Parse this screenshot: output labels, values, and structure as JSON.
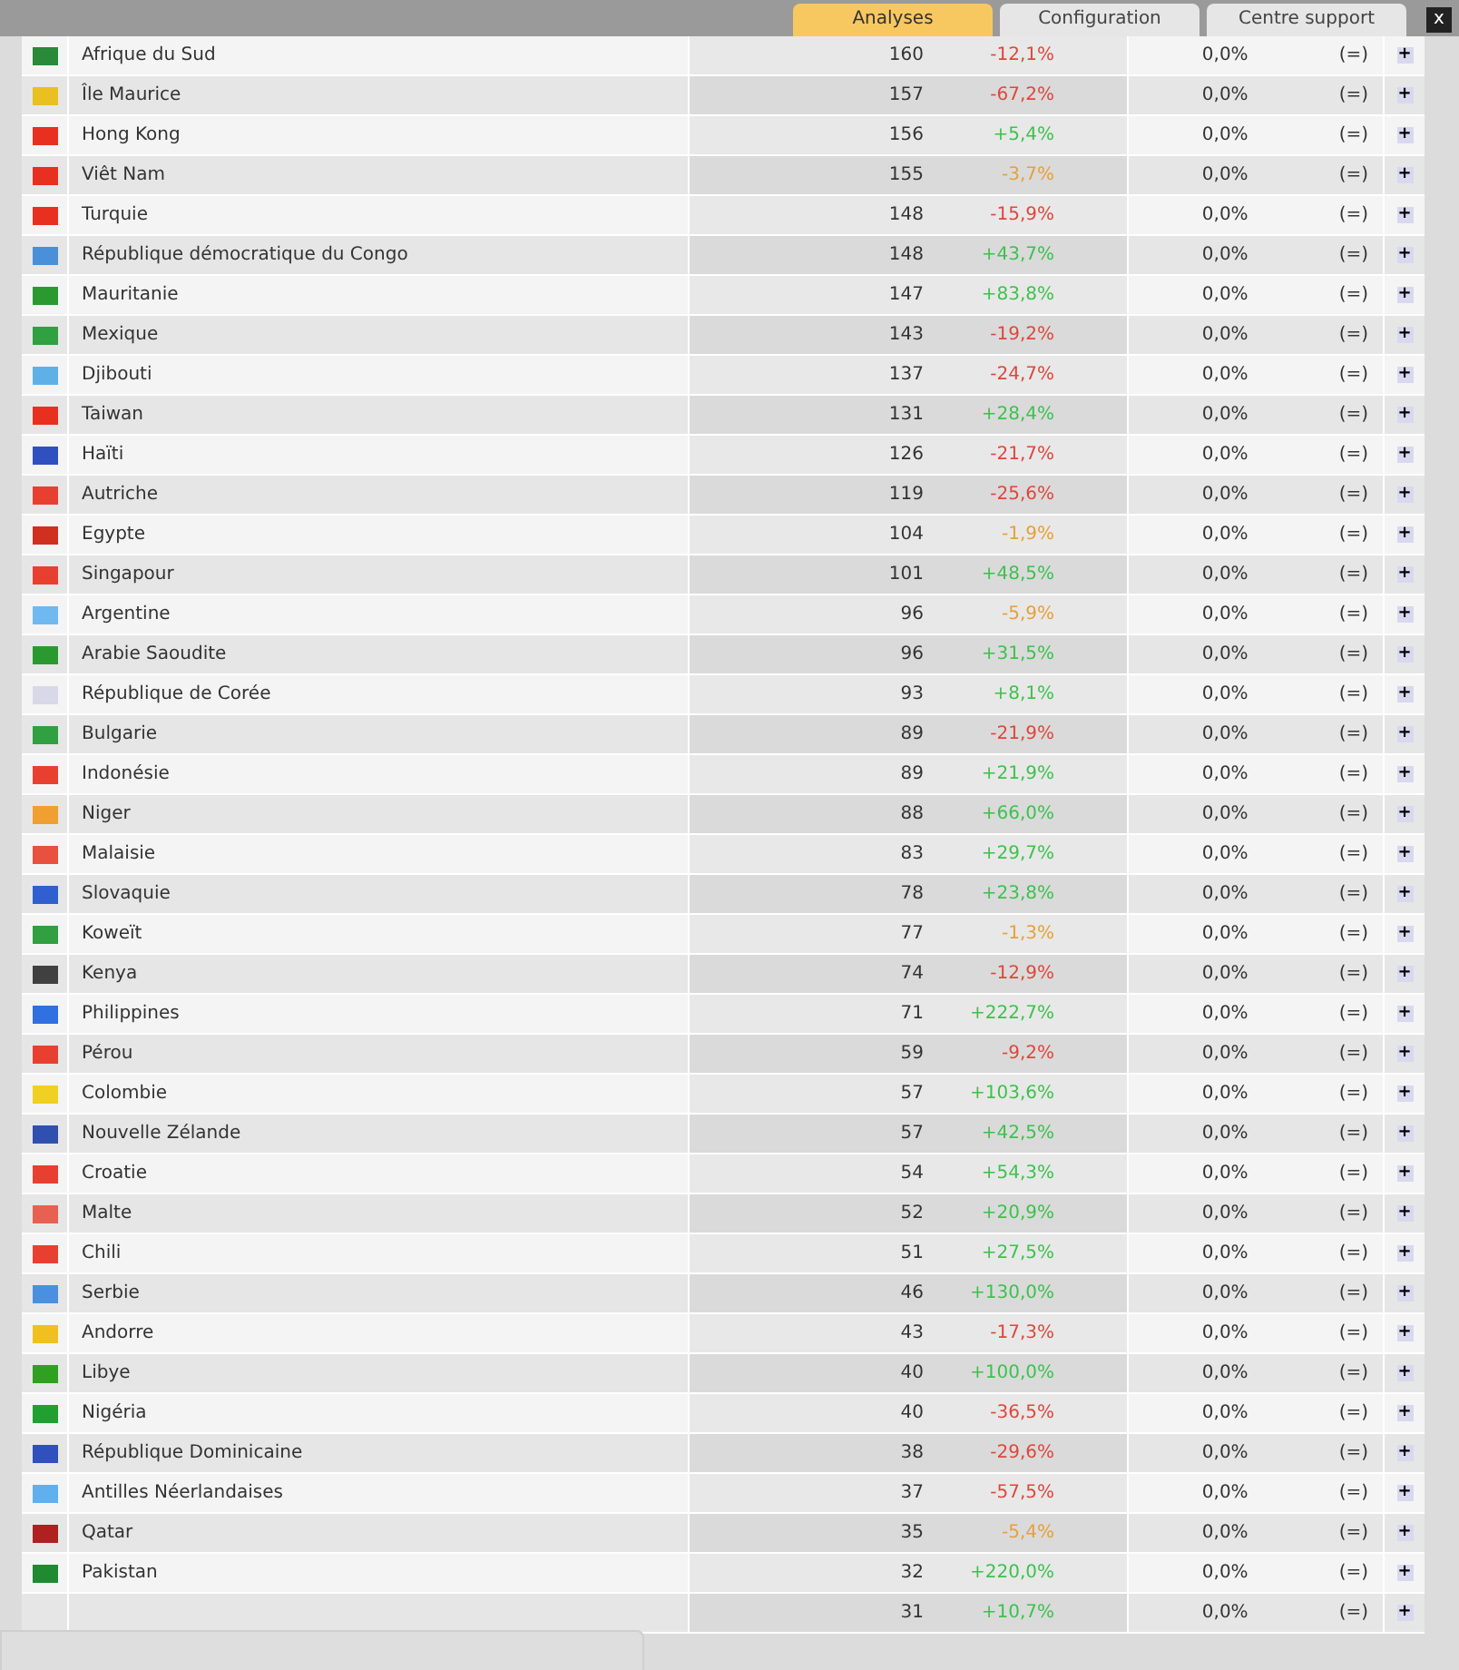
{
  "tabs": [
    {
      "label": "Analyses",
      "selected": true
    },
    {
      "label": "Configuration",
      "selected": false
    },
    {
      "label": "Centre support",
      "selected": false
    }
  ],
  "close": "x",
  "rows": [
    {
      "country": "Afrique du Sud",
      "color": "#2a8a3a",
      "count": "160",
      "change": "-12,1%",
      "kind": "down",
      "share": "0,0%",
      "delta": "(=)",
      "action": "+"
    },
    {
      "country": "Île Maurice",
      "color": "#e8c020",
      "count": "157",
      "change": "-67,2%",
      "kind": "down",
      "share": "0,0%",
      "delta": "(=)",
      "action": "+"
    },
    {
      "country": "Hong Kong",
      "color": "#e83020",
      "count": "156",
      "change": "+5,4%",
      "kind": "up",
      "share": "0,0%",
      "delta": "(=)",
      "action": "+"
    },
    {
      "country": "Viêt Nam",
      "color": "#e83020",
      "count": "155",
      "change": "-3,7%",
      "kind": "flat",
      "share": "0,0%",
      "delta": "(=)",
      "action": "+"
    },
    {
      "country": "Turquie",
      "color": "#e83020",
      "count": "148",
      "change": "-15,9%",
      "kind": "down",
      "share": "0,0%",
      "delta": "(=)",
      "action": "+"
    },
    {
      "country": "République démocratique du Congo",
      "color": "#4a90d8",
      "count": "148",
      "change": "+43,7%",
      "kind": "up",
      "share": "0,0%",
      "delta": "(=)",
      "action": "+"
    },
    {
      "country": "Mauritanie",
      "color": "#2a9a30",
      "count": "147",
      "change": "+83,8%",
      "kind": "up",
      "share": "0,0%",
      "delta": "(=)",
      "action": "+"
    },
    {
      "country": "Mexique",
      "color": "#30a040",
      "count": "143",
      "change": "-19,2%",
      "kind": "down",
      "share": "0,0%",
      "delta": "(=)",
      "action": "+"
    },
    {
      "country": "Djibouti",
      "color": "#60b0e8",
      "count": "137",
      "change": "-24,7%",
      "kind": "down",
      "share": "0,0%",
      "delta": "(=)",
      "action": "+"
    },
    {
      "country": "Taiwan",
      "color": "#e83020",
      "count": "131",
      "change": "+28,4%",
      "kind": "up",
      "share": "0,0%",
      "delta": "(=)",
      "action": "+"
    },
    {
      "country": "Haïti",
      "color": "#3050c0",
      "count": "126",
      "change": "-21,7%",
      "kind": "down",
      "share": "0,0%",
      "delta": "(=)",
      "action": "+"
    },
    {
      "country": "Autriche",
      "color": "#e84030",
      "count": "119",
      "change": "-25,6%",
      "kind": "down",
      "share": "0,0%",
      "delta": "(=)",
      "action": "+"
    },
    {
      "country": "Egypte",
      "color": "#d03020",
      "count": "104",
      "change": "-1,9%",
      "kind": "flat",
      "share": "0,0%",
      "delta": "(=)",
      "action": "+"
    },
    {
      "country": "Singapour",
      "color": "#e84030",
      "count": "101",
      "change": "+48,5%",
      "kind": "up",
      "share": "0,0%",
      "delta": "(=)",
      "action": "+"
    },
    {
      "country": "Argentine",
      "color": "#70b8f0",
      "count": "96",
      "change": "-5,9%",
      "kind": "flat",
      "share": "0,0%",
      "delta": "(=)",
      "action": "+"
    },
    {
      "country": "Arabie Saoudite",
      "color": "#2a9a30",
      "count": "96",
      "change": "+31,5%",
      "kind": "up",
      "share": "0,0%",
      "delta": "(=)",
      "action": "+"
    },
    {
      "country": "République de Corée",
      "color": "#d8d8e8",
      "count": "93",
      "change": "+8,1%",
      "kind": "up",
      "share": "0,0%",
      "delta": "(=)",
      "action": "+"
    },
    {
      "country": "Bulgarie",
      "color": "#30a040",
      "count": "89",
      "change": "-21,9%",
      "kind": "down",
      "share": "0,0%",
      "delta": "(=)",
      "action": "+"
    },
    {
      "country": "Indonésie",
      "color": "#e84030",
      "count": "89",
      "change": "+21,9%",
      "kind": "up",
      "share": "0,0%",
      "delta": "(=)",
      "action": "+"
    },
    {
      "country": "Niger",
      "color": "#f0a030",
      "count": "88",
      "change": "+66,0%",
      "kind": "up",
      "share": "0,0%",
      "delta": "(=)",
      "action": "+"
    },
    {
      "country": "Malaisie",
      "color": "#e85040",
      "count": "83",
      "change": "+29,7%",
      "kind": "up",
      "share": "0,0%",
      "delta": "(=)",
      "action": "+"
    },
    {
      "country": "Slovaquie",
      "color": "#3060d0",
      "count": "78",
      "change": "+23,8%",
      "kind": "up",
      "share": "0,0%",
      "delta": "(=)",
      "action": "+"
    },
    {
      "country": "Koweït",
      "color": "#30a040",
      "count": "77",
      "change": "-1,3%",
      "kind": "flat",
      "share": "0,0%",
      "delta": "(=)",
      "action": "+"
    },
    {
      "country": "Kenya",
      "color": "#404040",
      "count": "74",
      "change": "-12,9%",
      "kind": "down",
      "share": "0,0%",
      "delta": "(=)",
      "action": "+"
    },
    {
      "country": "Philippines",
      "color": "#3070e0",
      "count": "71",
      "change": "+222,7%",
      "kind": "up",
      "share": "0,0%",
      "delta": "(=)",
      "action": "+"
    },
    {
      "country": "Pérou",
      "color": "#e84030",
      "count": "59",
      "change": "-9,2%",
      "kind": "down",
      "share": "0,0%",
      "delta": "(=)",
      "action": "+"
    },
    {
      "country": "Colombie",
      "color": "#f0d020",
      "count": "57",
      "change": "+103,6%",
      "kind": "up",
      "share": "0,0%",
      "delta": "(=)",
      "action": "+"
    },
    {
      "country": "Nouvelle Zélande",
      "color": "#3050b0",
      "count": "57",
      "change": "+42,5%",
      "kind": "up",
      "share": "0,0%",
      "delta": "(=)",
      "action": "+"
    },
    {
      "country": "Croatie",
      "color": "#e84030",
      "count": "54",
      "change": "+54,3%",
      "kind": "up",
      "share": "0,0%",
      "delta": "(=)",
      "action": "+"
    },
    {
      "country": "Malte",
      "color": "#e86050",
      "count": "52",
      "change": "+20,9%",
      "kind": "up",
      "share": "0,0%",
      "delta": "(=)",
      "action": "+"
    },
    {
      "country": "Chili",
      "color": "#e84030",
      "count": "51",
      "change": "+27,5%",
      "kind": "up",
      "share": "0,0%",
      "delta": "(=)",
      "action": "+"
    },
    {
      "country": "Serbie",
      "color": "#4a90e0",
      "count": "46",
      "change": "+130,0%",
      "kind": "up",
      "share": "0,0%",
      "delta": "(=)",
      "action": "+"
    },
    {
      "country": "Andorre",
      "color": "#f0c020",
      "count": "43",
      "change": "-17,3%",
      "kind": "down",
      "share": "0,0%",
      "delta": "(=)",
      "action": "+"
    },
    {
      "country": "Libye",
      "color": "#30a020",
      "count": "40",
      "change": "+100,0%",
      "kind": "up",
      "share": "0,0%",
      "delta": "(=)",
      "action": "+"
    },
    {
      "country": "Nigéria",
      "color": "#20a030",
      "count": "40",
      "change": "-36,5%",
      "kind": "down",
      "share": "0,0%",
      "delta": "(=)",
      "action": "+"
    },
    {
      "country": "République Dominicaine",
      "color": "#3050c0",
      "count": "38",
      "change": "-29,6%",
      "kind": "down",
      "share": "0,0%",
      "delta": "(=)",
      "action": "+"
    },
    {
      "country": "Antilles Néerlandaises",
      "color": "#60b0f0",
      "count": "37",
      "change": "-57,5%",
      "kind": "down",
      "share": "0,0%",
      "delta": "(=)",
      "action": "+"
    },
    {
      "country": "Qatar",
      "color": "#b02020",
      "count": "35",
      "change": "-5,4%",
      "kind": "flat",
      "share": "0,0%",
      "delta": "(=)",
      "action": "+"
    },
    {
      "country": "Pakistan",
      "color": "#208a30",
      "count": "32",
      "change": "+220,0%",
      "kind": "up",
      "share": "0,0%",
      "delta": "(=)",
      "action": "+"
    },
    {
      "count": "31",
      "change": "+10,7%",
      "kind": "up",
      "share": "0,0%",
      "delta": "(=)",
      "action": "+"
    }
  ]
}
